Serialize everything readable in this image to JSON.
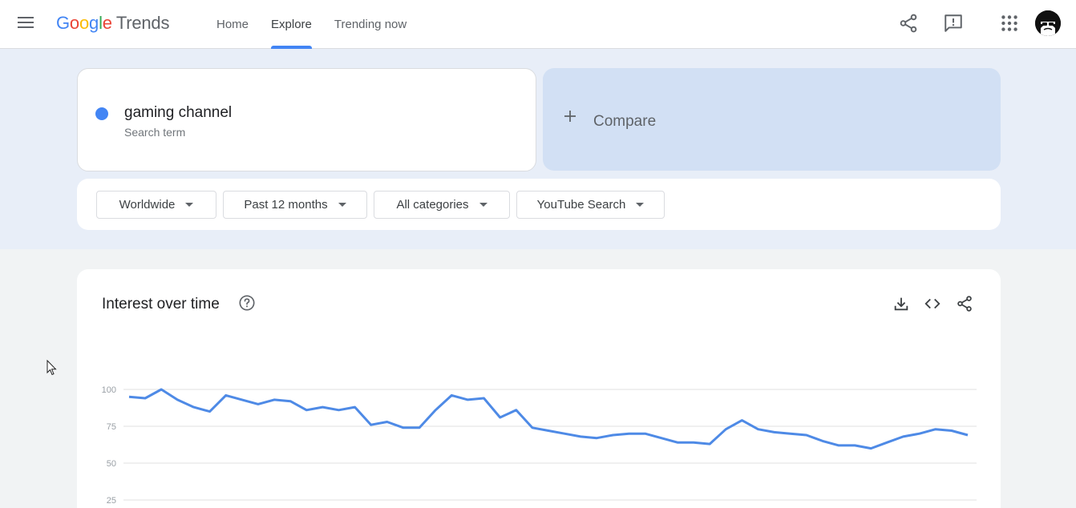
{
  "header": {
    "logo_google": [
      "G",
      "o",
      "o",
      "g",
      "l",
      "e"
    ],
    "logo_trends": "Trends",
    "nav": [
      {
        "label": "Home",
        "active": false
      },
      {
        "label": "Explore",
        "active": true
      },
      {
        "label": "Trending now",
        "active": false
      }
    ],
    "icons": [
      "menu-icon",
      "share-icon",
      "feedback-icon",
      "apps-icon",
      "avatar"
    ]
  },
  "search": {
    "term": "gaming channel",
    "term_type": "Search term",
    "term_color": "#4285f4",
    "compare_label": "Compare"
  },
  "filters": {
    "region": "Worldwide",
    "time": "Past 12 months",
    "category": "All categories",
    "property": "YouTube Search"
  },
  "chart": {
    "title": "Interest over time",
    "icons": [
      "help-icon",
      "download-icon",
      "embed-icon",
      "share-icon"
    ]
  },
  "chart_data": {
    "type": "line",
    "yticks": [
      100,
      75,
      50,
      25
    ],
    "ylim": [
      0,
      100
    ],
    "grid": true,
    "series": [
      {
        "color": "#4e8ae6",
        "values": [
          95,
          94,
          100,
          93,
          88,
          85,
          96,
          93,
          90,
          93,
          92,
          86,
          88,
          86,
          88,
          76,
          78,
          74,
          74,
          86,
          96,
          93,
          94,
          81,
          86,
          74,
          72,
          70,
          68,
          67,
          69,
          70,
          70,
          67,
          64,
          64,
          63,
          73,
          79,
          73,
          71,
          70,
          69,
          65,
          62,
          62,
          60,
          64,
          68,
          70,
          73,
          72,
          69
        ]
      }
    ]
  }
}
